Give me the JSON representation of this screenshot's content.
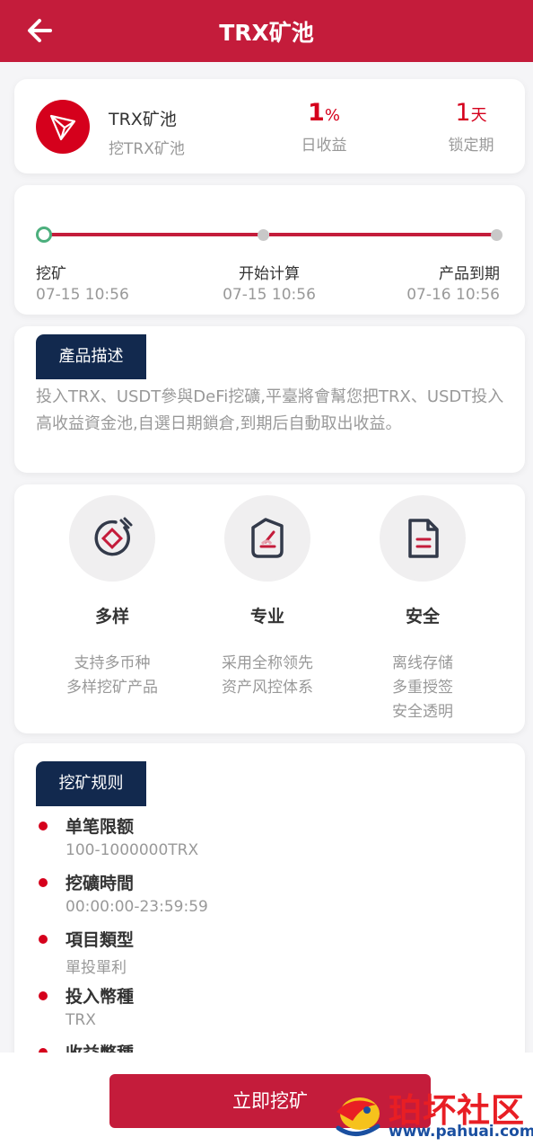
{
  "header": {
    "title": "TRX矿池"
  },
  "summary": {
    "name": "TRX矿池",
    "subtitle": "挖TRX矿池",
    "daily_rate_value": "1",
    "daily_rate_unit": "%",
    "daily_rate_label": "日收益",
    "lock_value": "1",
    "lock_unit": "天",
    "lock_label": "锁定期"
  },
  "timeline": {
    "start_label": "挖矿",
    "start_time": "07-15 10:56",
    "calc_label": "开始计算",
    "calc_time": "07-15 10:56",
    "expire_label": "产品到期",
    "expire_time": "07-16 10:56"
  },
  "description": {
    "tag": "產品描述",
    "text": "投入TRX、USDT參與DeFi挖礦,平臺將會幫您把TRX、USDT投入高收益資金池,自選日期鎖倉,到期后自動取出收益。"
  },
  "features": [
    {
      "title": "多样",
      "lines": [
        "支持多币种",
        "多样挖矿产品"
      ],
      "icon": "coin-icon"
    },
    {
      "title": "专业",
      "lines": [
        "采用全称领先",
        "资产风控体系"
      ],
      "icon": "shield-icon"
    },
    {
      "title": "安全",
      "lines": [
        "离线存储",
        "多重授签",
        "安全透明"
      ],
      "icon": "document-icon"
    }
  ],
  "rules": {
    "tag": "挖矿规则",
    "items": [
      {
        "title": "单笔限额",
        "value": "100-1000000TRX"
      },
      {
        "title": "挖礦時間",
        "value": "00:00:00-23:59:59"
      },
      {
        "title": "項目類型",
        "value": "單投單利"
      },
      {
        "title": "投入幣種",
        "value": "TRX"
      },
      {
        "title": "收益幣種",
        "value": ""
      }
    ]
  },
  "action": {
    "button_label": "立即挖矿"
  },
  "watermark": {
    "text": "珀坏社区",
    "url": "www.pahuai.com"
  },
  "colors": {
    "primary": "#c41c3b",
    "accent": "#d5001c",
    "tag_bg": "#12294e",
    "success": "#4caf7d"
  }
}
